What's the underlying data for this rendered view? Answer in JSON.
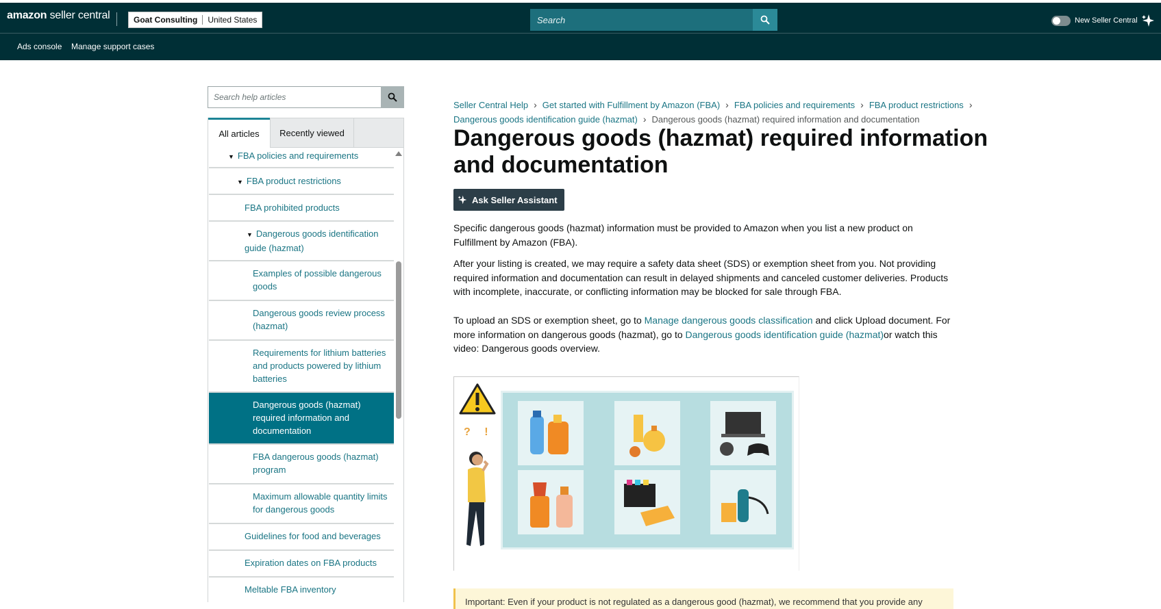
{
  "header": {
    "logo_prefix": "amazon",
    "logo_suffix": " seller central",
    "account_name": "Goat Consulting",
    "marketplace": "United States",
    "search_placeholder": "Search",
    "new_seller_central": "New Seller Central"
  },
  "subnav": [
    "Ads console",
    "Manage support cases"
  ],
  "help_search": {
    "placeholder": "Search help articles"
  },
  "tabs": [
    "All articles",
    "Recently viewed"
  ],
  "nav_items": [
    {
      "label": "FBA policies and requirements",
      "expanded": true
    },
    {
      "label": "FBA product restrictions",
      "expanded": true
    },
    {
      "label": "FBA prohibited products"
    },
    {
      "label": "Dangerous goods identification guide (hazmat)",
      "expanded": true
    },
    {
      "label": "Examples of possible dangerous goods"
    },
    {
      "label": "Dangerous goods review process (hazmat)"
    },
    {
      "label": "Requirements for lithium batteries and products powered by lithium batteries"
    },
    {
      "label": "Dangerous goods (hazmat) required information and documentation",
      "active": true
    },
    {
      "label": "FBA dangerous goods (hazmat) program"
    },
    {
      "label": "Maximum allowable quantity limits for dangerous goods"
    },
    {
      "label": "Guidelines for food and beverages"
    },
    {
      "label": "Expiration dates on FBA products"
    },
    {
      "label": "Meltable FBA inventory"
    }
  ],
  "breadcrumbs": [
    "Seller Central Help",
    "Get started with Fulfillment by Amazon (FBA)",
    "FBA policies and requirements",
    "FBA product restrictions",
    "Dangerous goods identification guide (hazmat)",
    "Dangerous goods (hazmat) required information and documentation"
  ],
  "article": {
    "title": "Dangerous goods (hazmat) required information and documentation",
    "ask_button": "Ask Seller Assistant",
    "p1": "Specific dangerous goods (hazmat) information must be provided to Amazon when you list a new product on Fulfillment by Amazon (FBA).",
    "p2": "After your listing is created, we may require a safety data sheet (SDS) or exemption sheet from you. Not providing required information and documentation can result in delayed shipments and canceled customer deliveries. Products with incomplete, inaccurate, or conflicting information may be blocked for sale through FBA.",
    "p3_a": "To upload an SDS or exemption sheet, go to ",
    "p3_link1": "Manage dangerous goods classification",
    "p3_b": " and click Upload document. For more information on dangerous goods (hazmat), go to ",
    "p3_link2": "Dangerous goods identification guide (hazmat)",
    "p3_c": "or watch this video: Dangerous goods overview.",
    "qmarks": "? !",
    "note": "Important: Even if your product is not regulated as a dangerous good (hazmat), we recommend that you provide any"
  },
  "colors": {
    "header_bg": "#002f36",
    "link": "#1a7584",
    "active_nav": "#007185"
  }
}
